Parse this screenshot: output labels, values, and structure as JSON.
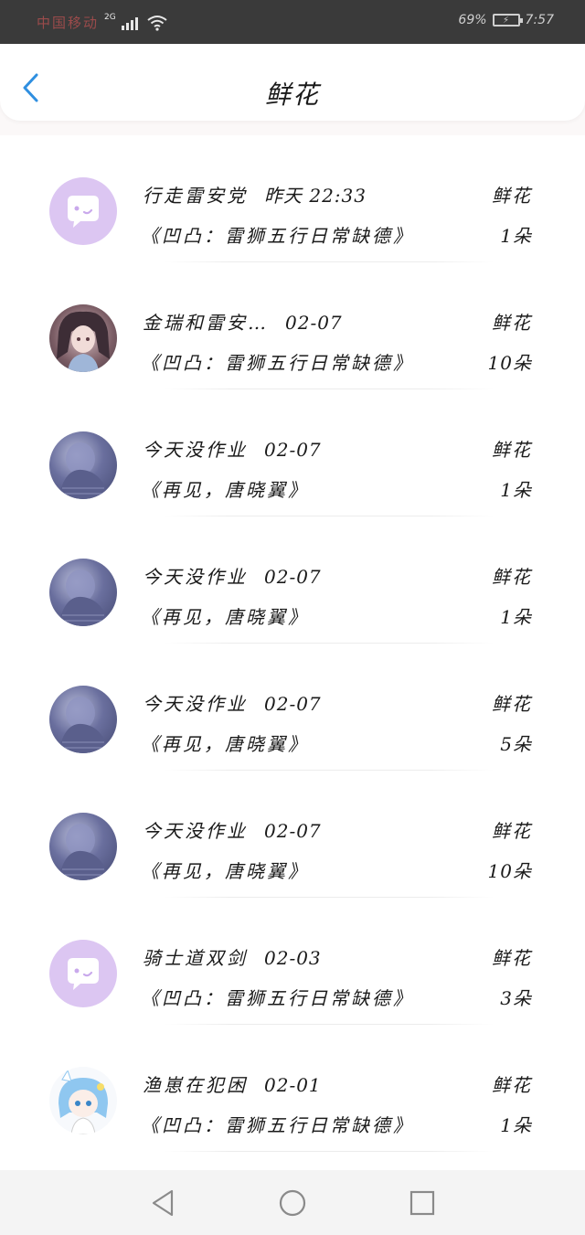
{
  "status_bar": {
    "carrier": "中国移动",
    "network": "2G",
    "battery": "69%",
    "time": "7:57"
  },
  "header": {
    "title": "鲜花"
  },
  "items": [
    {
      "name": "行走雷安党",
      "time": "昨天 22:33",
      "work": "《凹凸：雷狮五行日常缺德》",
      "gift": "鲜花",
      "count": "1朵",
      "avatar": "bubble-icon"
    },
    {
      "name": "金瑞和雷安…",
      "time": "02-07",
      "work": "《凹凸：雷狮五行日常缺德》",
      "gift": "鲜花",
      "count": "10朵",
      "avatar": "anime-girl"
    },
    {
      "name": "今天没作业",
      "time": "02-07",
      "work": "《再见，唐晓翼》",
      "gift": "鲜花",
      "count": "1朵",
      "avatar": "dark-figure"
    },
    {
      "name": "今天没作业",
      "time": "02-07",
      "work": "《再见，唐晓翼》",
      "gift": "鲜花",
      "count": "1朵",
      "avatar": "dark-figure"
    },
    {
      "name": "今天没作业",
      "time": "02-07",
      "work": "《再见，唐晓翼》",
      "gift": "鲜花",
      "count": "5朵",
      "avatar": "dark-figure"
    },
    {
      "name": "今天没作业",
      "time": "02-07",
      "work": "《再见，唐晓翼》",
      "gift": "鲜花",
      "count": "10朵",
      "avatar": "dark-figure"
    },
    {
      "name": "骑士道双剑",
      "time": "02-03",
      "work": "《凹凸：雷狮五行日常缺德》",
      "gift": "鲜花",
      "count": "3朵",
      "avatar": "bubble-icon"
    },
    {
      "name": "渔崽在犯困",
      "time": "02-01",
      "work": "《凹凸：雷狮五行日常缺德》",
      "gift": "鲜花",
      "count": "1朵",
      "avatar": "blue-hair-chibi"
    }
  ],
  "nav": {
    "back": "triangle-back-icon",
    "home": "circle-home-icon",
    "recent": "square-recent-icon"
  },
  "colors": {
    "accent": "#2f8fe0",
    "bubble_avatar": "#dcc6f2",
    "status_bar": "#3a3a3a"
  }
}
